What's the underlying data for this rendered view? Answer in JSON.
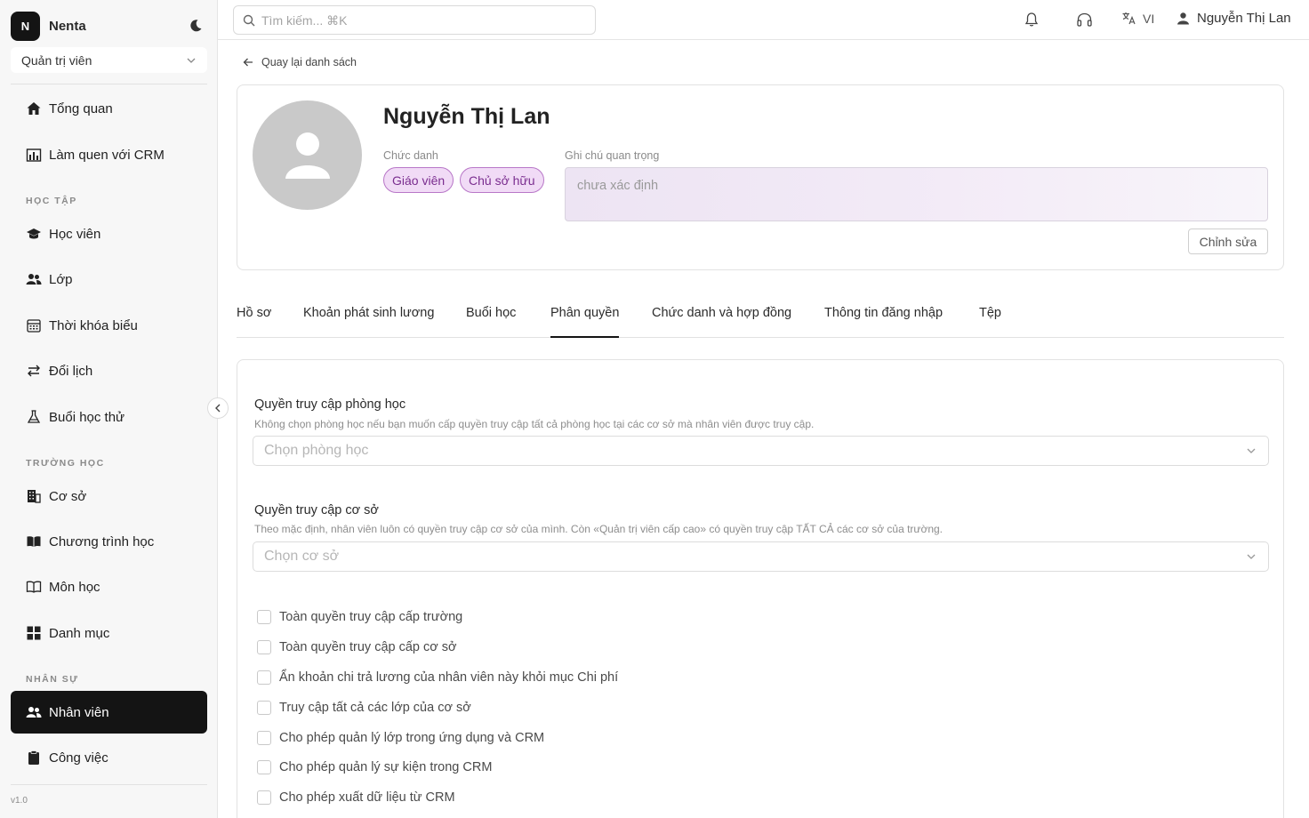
{
  "brand": {
    "initial": "N",
    "name": "Nenta"
  },
  "role_select": {
    "value": "Quản trị viên"
  },
  "nav": {
    "overview": "Tổng quan",
    "intro_crm": "Làm quen với CRM",
    "section_study": "HỌC TẬP",
    "students": "Học viên",
    "classes": "Lớp",
    "timetable": "Thời khóa biểu",
    "reschedule": "Đổi lịch",
    "trial": "Buổi học thử",
    "section_school": "TRƯỜNG HỌC",
    "branches": "Cơ sở",
    "programs": "Chương trình học",
    "subjects": "Môn học",
    "categories": "Danh mục",
    "section_hr": "NHÂN SỰ",
    "staff": "Nhân viên",
    "tasks": "Công việc"
  },
  "version": "v1.0",
  "topbar": {
    "search_placeholder": "Tìm kiếm... ⌘K",
    "lang": "VI",
    "user_name": "Nguyễn Thị Lan"
  },
  "back_link": "Quay lại danh sách",
  "profile": {
    "name": "Nguyễn Thị Lan",
    "title_label": "Chức danh",
    "roles": [
      "Giáo viên",
      "Chủ sở hữu"
    ],
    "note_label": "Ghi chú quan trọng",
    "note_value": "chưa xác định",
    "edit_button": "Chỉnh sửa"
  },
  "tabs": [
    "Hồ sơ",
    "Khoản phát sinh lương",
    "Buổi học",
    "Phân quyền",
    "Chức danh và hợp đồng",
    "Thông tin đăng nhập",
    "Tệp"
  ],
  "active_tab": "Phân quyền",
  "permissions": {
    "room_title": "Quyền truy cập phòng học",
    "room_desc": "Không chọn phòng học nếu bạn muốn cấp quyền truy cập tất cả phòng học tại các cơ sở mà nhân viên được truy cập.",
    "room_placeholder": "Chọn phòng học",
    "branch_title": "Quyền truy cập cơ sở",
    "branch_desc": "Theo mặc định, nhân viên luôn có quyền truy cập cơ sở của mình. Còn «Quản trị viên cấp cao» có quyền truy cập TẤT CẢ các cơ sở của trường.",
    "branch_placeholder": "Chọn cơ sở",
    "checks": [
      "Toàn quyền truy cập cấp trường",
      "Toàn quyền truy cập cấp cơ sở",
      "Ẩn khoản chi trả lương của nhân viên này khỏi mục Chi phí",
      "Truy cập tất cả các lớp của cơ sở",
      "Cho phép quản lý lớp trong ứng dụng và CRM",
      "Cho phép quản lý sự kiện trong CRM",
      "Cho phép xuất dữ liệu từ CRM"
    ]
  },
  "colors": {
    "accent_dark": "#141414",
    "chip_bg": "#f1dbf6",
    "chip_border": "#b877c8",
    "chip_text": "#7a2d8f"
  }
}
